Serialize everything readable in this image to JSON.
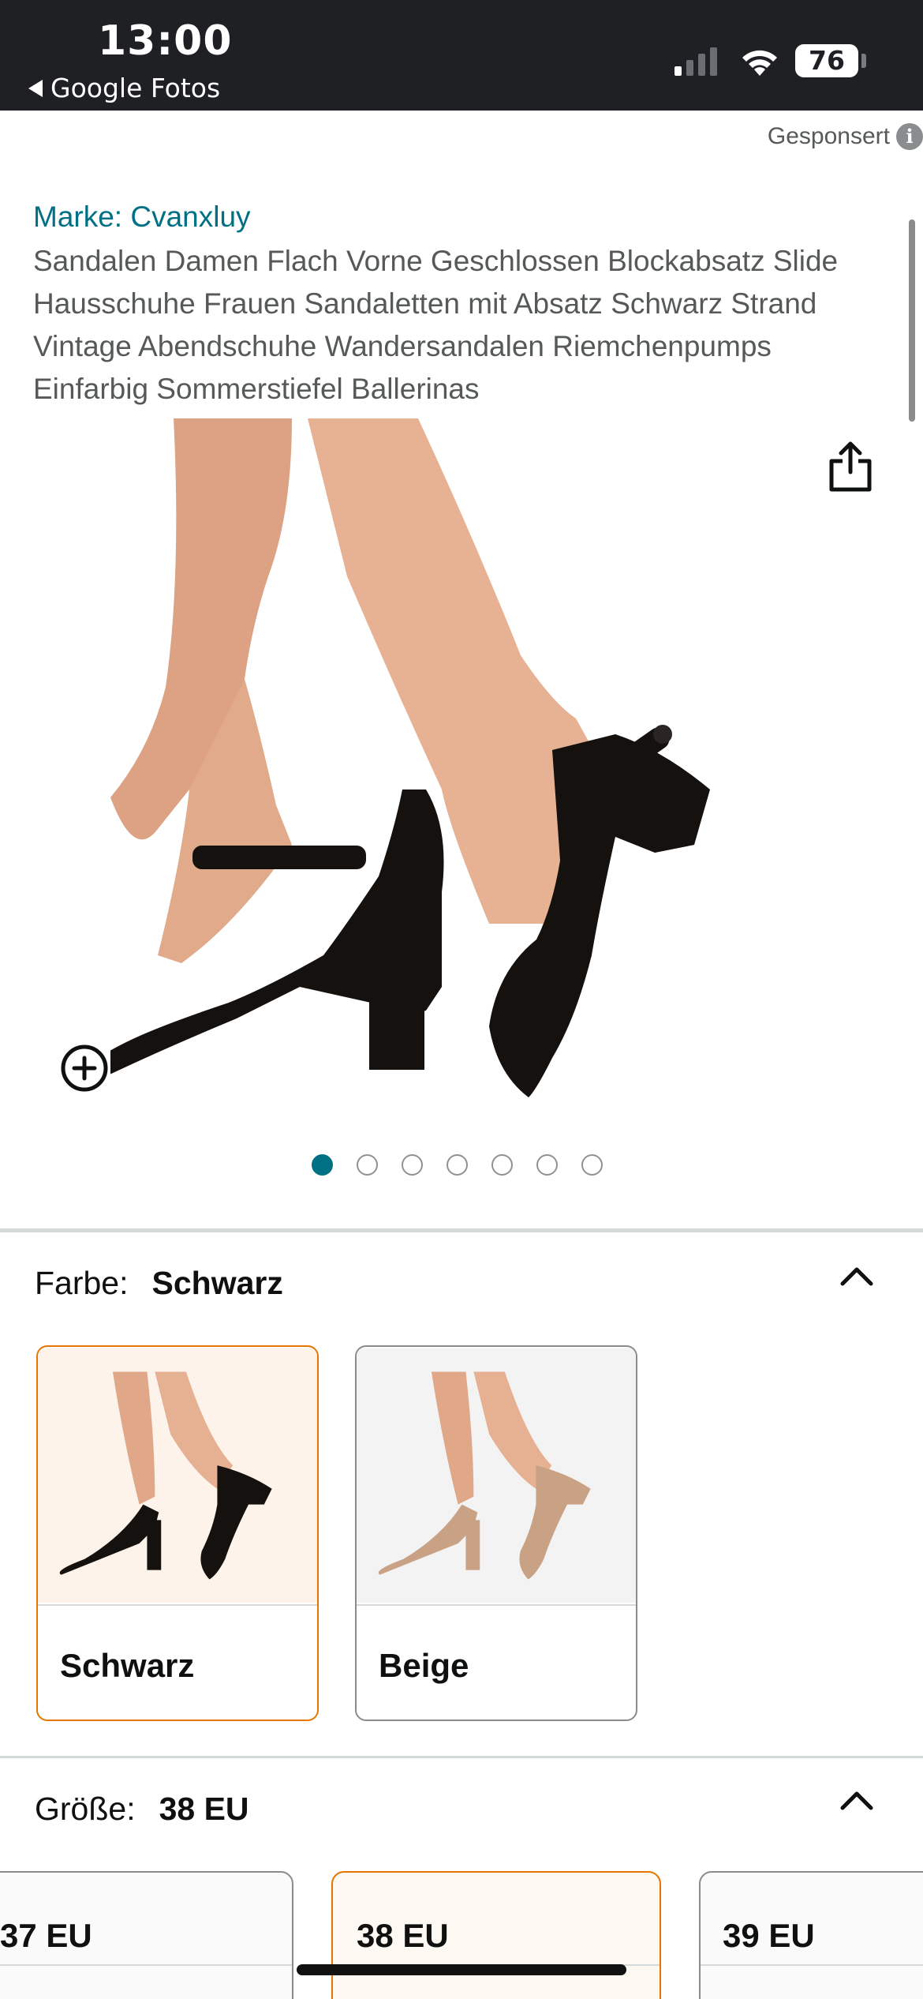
{
  "status_bar": {
    "time": "13:00",
    "back_app": "Google Fotos",
    "battery": "76"
  },
  "sponsored": {
    "label": "Gesponsert",
    "info_glyph": "i"
  },
  "product": {
    "brand": "Marke: Cvanxluy",
    "title": "Sandalen Damen Flach Vorne Geschlossen Blockabsatz Slide Hausschuhe Frauen Sandaletten mit Absatz Schwarz Strand Vintage Abendschuhe Wandersandalen Riemchenpumps Einfarbig Sommerstiefel Ballerinas",
    "image_count": 7,
    "active_image": 1
  },
  "color_section": {
    "label": "Farbe:",
    "selected": "Schwarz",
    "options": [
      {
        "label": "Schwarz",
        "selected": true,
        "shoe_color": "#14110f"
      },
      {
        "label": "Beige",
        "selected": false,
        "shoe_color": "#c9a185"
      }
    ]
  },
  "size_section": {
    "label": "Größe:",
    "selected": "38 EU",
    "options": [
      {
        "label": "37 EU",
        "selected": false
      },
      {
        "label": "38 EU",
        "selected": true
      },
      {
        "label": "39 EU",
        "selected": false
      }
    ]
  },
  "colors": {
    "link": "#007185",
    "accent": "#e77600",
    "status_bar_bg": "#1f2024"
  },
  "icons": [
    "back-arrow-icon",
    "signal-icon",
    "wifi-icon",
    "battery-icon",
    "info-icon",
    "share-icon",
    "zoom-icon",
    "chevron-up-icon"
  ]
}
